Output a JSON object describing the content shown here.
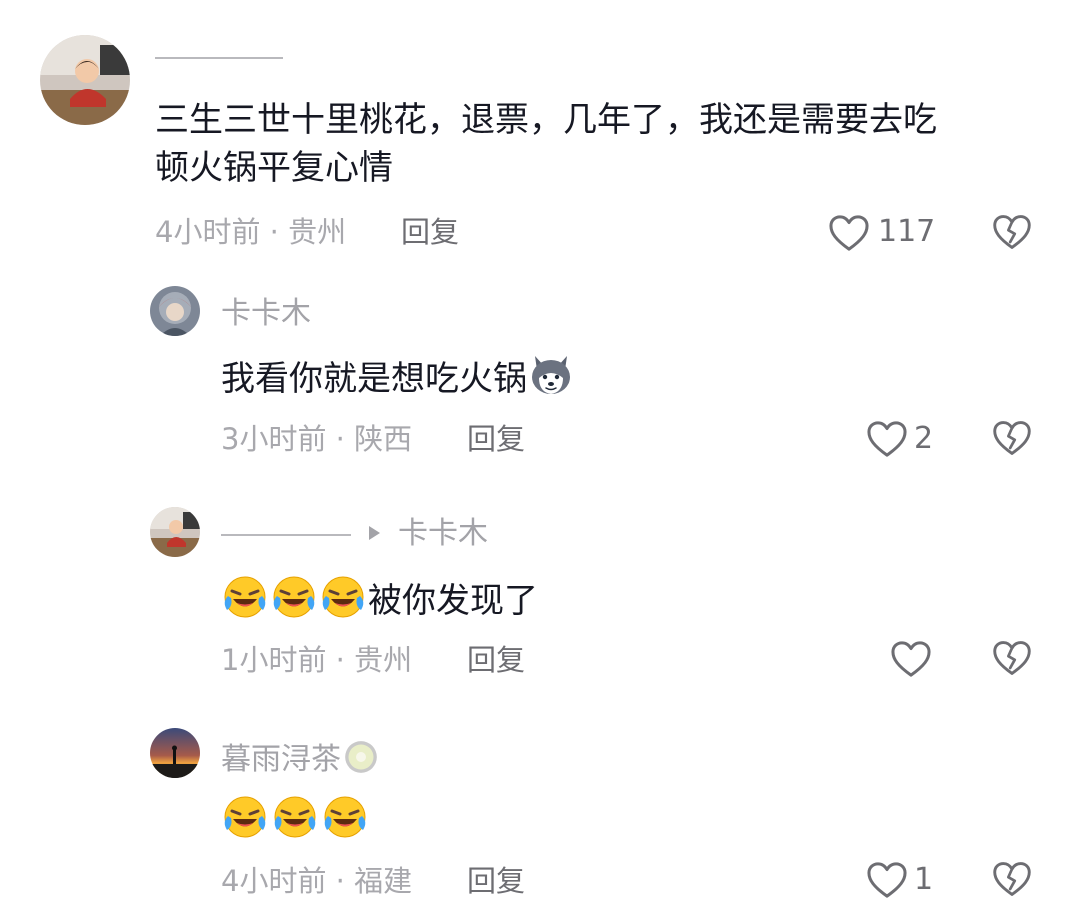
{
  "comments": [
    {
      "text": "三生三世十里桃花，退票，几年了，我还是需要去吃顿火锅平复心情",
      "text_line1": "三生三世十里桃花，退票，几年了，我还是需要去吃",
      "text_line2": "顿火锅平复心情",
      "time": "4小时前",
      "location": "贵州",
      "meta": "4小时前 · 贵州",
      "reply_label": "回复",
      "likes": "117",
      "replies": [
        {
          "username": "卡卡木",
          "text": "我看你就是想吃火锅",
          "text_emoji": "husky-dog-emoji",
          "meta": "3小时前 · 陕西",
          "reply_label": "回复",
          "likes": "2"
        },
        {
          "reply_to": "卡卡木",
          "text": "被你发现了",
          "leading_emojis": [
            "laughing-crying-emoji",
            "laughing-crying-emoji",
            "laughing-crying-emoji"
          ],
          "meta": "1小时前 · 贵州",
          "reply_label": "回复",
          "likes": ""
        }
      ]
    },
    {
      "username": "暮雨浔茶",
      "username_emoji": "kiwi-emoji",
      "emojis": [
        "laughing-crying-emoji",
        "laughing-crying-emoji",
        "laughing-crying-emoji"
      ],
      "meta": "4小时前 · 福建",
      "reply_label": "回复",
      "likes": "1"
    }
  ],
  "colors": {
    "text_primary": "#161823",
    "text_secondary": "#a3a3a8",
    "reply_gray": "#6d6d72",
    "icon_gray": "#6d6d72"
  }
}
